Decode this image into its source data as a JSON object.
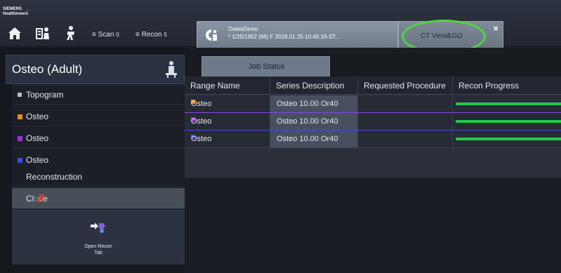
{
  "brand": {
    "line1": "SIEMENS",
    "line2": "Healthineers"
  },
  "nav": {
    "scan_label": "Scan",
    "scan_count": "0",
    "recon_label": "Recon",
    "recon_count": "5"
  },
  "tabs": {
    "patient_name": "OsteoDemo",
    "patient_info": "* 1/25/1952 (66) F 2018.01.25-10:45:16-ST...",
    "ct_view_label": "CT View&GO",
    "close_symbol": "×"
  },
  "sidebar": {
    "title": "Osteo (Adult)",
    "items": [
      {
        "label": "Topogram",
        "swatch": "#bdbdbd"
      },
      {
        "label": "Osteo",
        "swatch": "#f28c1c"
      },
      {
        "label": "Osteo",
        "swatch": "#9b2fe0"
      },
      {
        "label": "Osteo",
        "swatch": "#3a4cf0"
      }
    ],
    "reconstruction_label": "Reconstruction",
    "close_label_left": "Cl",
    "close_label_right": "se",
    "close_mark": "✗",
    "open_recon_line1": "Open Recon",
    "open_recon_line2": "Tab"
  },
  "job_status": {
    "tab_label": "Job Status",
    "columns": [
      "Range Name",
      "Series Description",
      "Requested Procedure",
      "Recon Progress"
    ],
    "rows": [
      {
        "range_name": "Osteo",
        "series": "Osteo  10.00  Or40",
        "procedure": "",
        "color": "#f28c1c",
        "divider": "#8a42e0",
        "progress": 1.0
      },
      {
        "range_name": "Osteo",
        "series": "Osteo  10.00  Or40",
        "procedure": "",
        "color": "#9b2fe0",
        "divider": "#3a4cf0",
        "progress": 1.0
      },
      {
        "range_name": "Osteo",
        "series": "Osteo  10.00  Or40",
        "procedure": "",
        "color": "#3a4cf0",
        "divider": "#3a4150",
        "progress": 1.0
      }
    ]
  },
  "colors": {
    "highlight_ring": "#4fd73a",
    "progress_green": "#1fc94a",
    "close_mark": "#e33b2e"
  }
}
